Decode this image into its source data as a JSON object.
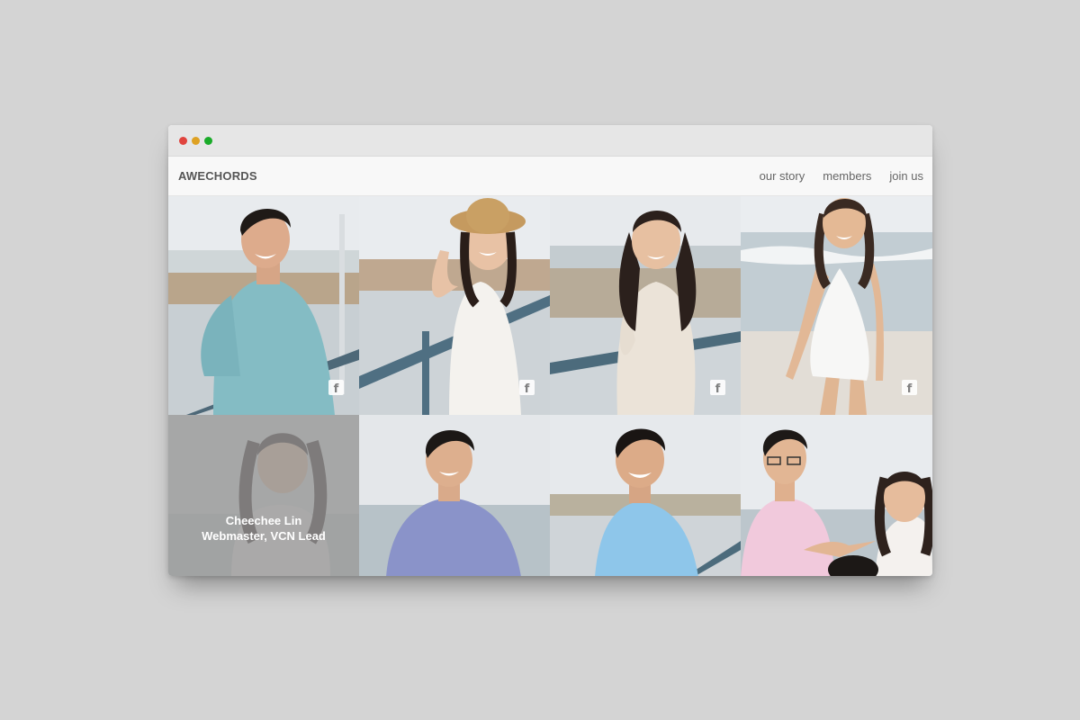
{
  "colors": {
    "background": "#d4d4d4",
    "chrome": "#e6e6e6",
    "dot_red": "#e0443e",
    "dot_yellow": "#dea123",
    "dot_green": "#1aab29",
    "navbar": "#f8f8f8"
  },
  "navbar": {
    "brand": "AWECHORDS",
    "links": [
      "our story",
      "members",
      "join us"
    ]
  },
  "members": {
    "hover_name": "Cheechee Lin",
    "hover_role": "Webmaster, VCN Lead",
    "facebook_icon": "facebook-icon",
    "facebook_glyph": "f"
  }
}
